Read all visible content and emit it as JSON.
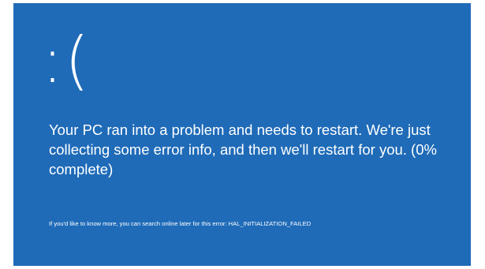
{
  "screen": {
    "background_color": "#1f6bb8",
    "frame_color": "#ffffff",
    "text_color": "#ffffff",
    "face": ":(",
    "message": "Your PC ran into a problem and needs to restart. We're just collecting some error info, and then we'll restart for you. (0% complete)",
    "detail": "If you'd like to know more, you can search online later for this error: HAL_INITIALIZATION_FAILED"
  }
}
